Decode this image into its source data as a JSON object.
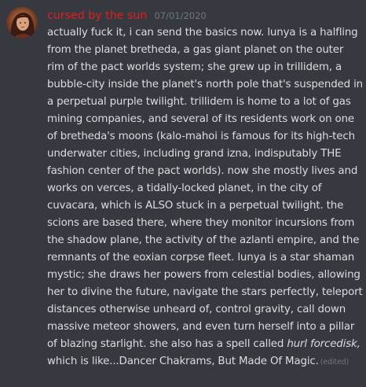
{
  "message": {
    "author": "cursed by the sun",
    "timestamp": "07/01/2020",
    "author_color": "#e01f1f",
    "avatar_icon": "user-avatar",
    "text_before_italic": "actually fuck it, i can send the basics now. lunya is a halfling from the planet bretheda, a gas giant planet on the outer rim of the pact worlds system; she grew up in trillidem, a bubble-city inside the planet's north pole that's suspended in a perpetual purple twilight. trillidem is home to a lot of gas mining companies, and several of its residents work on one of bretheda's moons (kalo-mahoi is famous for its high-tech underwater cities, including grand izna, indisputably THE fashion center of the pact worlds). now she mostly lives and works on verces, a tidally-locked planet, in the city of cuvacara, which is ALSO stuck in a perpetual twilight. the scions are based there, where they monitor incursions from the shadow plane, the activity of the azlanti empire, and the remnants of the eoxian corpse fleet. lunya is a star shaman mystic; she draws her powers from celestial bodies, allowing her to divine the future, navigate the stars perfectly, teleport distances otherwise unheard of, control gravity, call down massive meteor showers, and even turn herself into a pillar of blazing starlight. she also has a spell called ",
    "italic_text": "hurl forcedisk,",
    "text_after_italic": " which is like...Dancer Chakrams, But Made Of Magic.",
    "edited_label": "(edited)"
  }
}
